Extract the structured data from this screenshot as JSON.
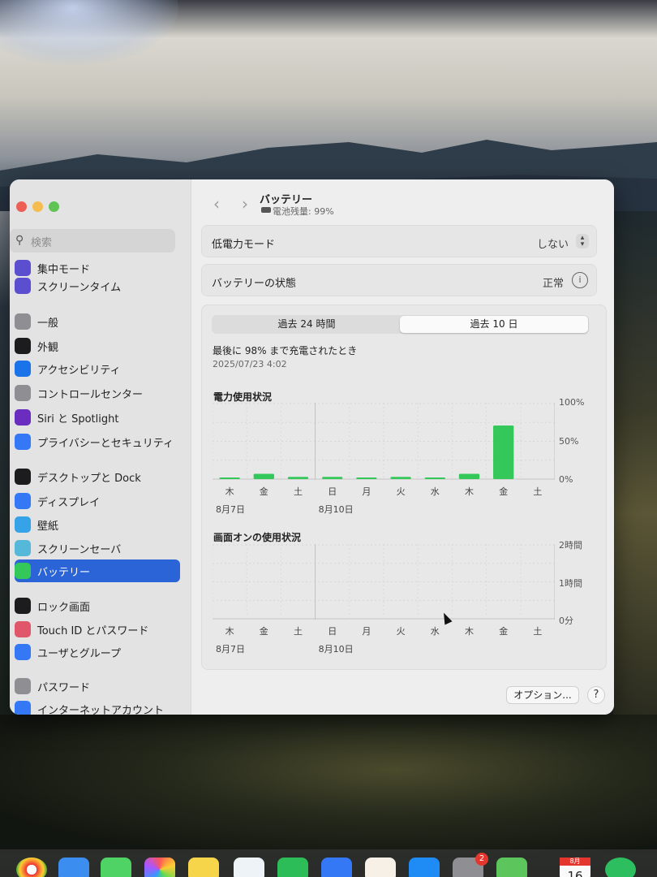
{
  "sidebar": {
    "search_placeholder": "検索",
    "items": [
      {
        "label": "集中モード",
        "icon": "moon-icon",
        "color": "#5b4fd0"
      },
      {
        "label": "スクリーンタイム",
        "icon": "hourglass-icon",
        "color": "#5b4fd0"
      },
      {
        "label": "一般",
        "icon": "gear-icon",
        "color": "#8e8e93"
      },
      {
        "label": "外観",
        "icon": "appearance-icon",
        "color": "#1c1c1e"
      },
      {
        "label": "アクセシビリティ",
        "icon": "accessibility-icon",
        "color": "#1a73e8"
      },
      {
        "label": "コントロールセンター",
        "icon": "control-center-icon",
        "color": "#8e8e93"
      },
      {
        "label": "Siri と Spotlight",
        "icon": "siri-icon",
        "color": "#6b2dbf"
      },
      {
        "label": "プライバシーとセキュリティ",
        "icon": "hand-icon",
        "color": "#3478f6"
      },
      {
        "label": "デスクトップと Dock",
        "icon": "desktop-icon",
        "color": "#1c1c1e"
      },
      {
        "label": "ディスプレイ",
        "icon": "sun-icon",
        "color": "#3478f6"
      },
      {
        "label": "壁紙",
        "icon": "flower-icon",
        "color": "#36a3e8"
      },
      {
        "label": "スクリーンセーバ",
        "icon": "screensaver-icon",
        "color": "#56b8d8"
      },
      {
        "label": "バッテリー",
        "icon": "battery-icon",
        "color": "#34c759"
      },
      {
        "label": "ロック画面",
        "icon": "lock-icon",
        "color": "#1c1c1e"
      },
      {
        "label": "Touch ID とパスワード",
        "icon": "fingerprint-icon",
        "color": "#e0566a"
      },
      {
        "label": "ユーザとグループ",
        "icon": "users-icon",
        "color": "#3478f6"
      },
      {
        "label": "パスワード",
        "icon": "key-icon",
        "color": "#8e8e93"
      },
      {
        "label": "インターネットアカウント",
        "icon": "at-icon",
        "color": "#3478f6"
      }
    ]
  },
  "header": {
    "title": "バッテリー",
    "battery_level": "電池残量: 99%"
  },
  "low_power": {
    "label": "低電力モード",
    "value": "しない"
  },
  "battery_health": {
    "label": "バッテリーの状態",
    "value": "正常"
  },
  "tabs": [
    {
      "label": "過去 24 時間",
      "active": false
    },
    {
      "label": "過去 10 日",
      "active": true
    }
  ],
  "last_charged": {
    "text": "最後に 98% まで充電されたとき",
    "date": "2025/07/23 4:02"
  },
  "buttons": {
    "options": "オプション...",
    "help": "?"
  },
  "dock": {
    "calendar_month": "8月",
    "calendar_day": "16",
    "badge": "2"
  },
  "chart_data": [
    {
      "type": "bar",
      "title": "電力使用状況",
      "categories": [
        "木",
        "金",
        "土",
        "日",
        "月",
        "火",
        "水",
        "木",
        "金",
        "土"
      ],
      "values": [
        1,
        7,
        3,
        3,
        1,
        3,
        2,
        7,
        71,
        0
      ],
      "ylim": [
        0,
        100
      ],
      "yticks": [
        "100%",
        "50%",
        "0%"
      ],
      "date_labels": [
        "8月7日",
        "8月10日"
      ],
      "color": "#34c759"
    },
    {
      "type": "bar",
      "title": "画面オンの使用状況",
      "categories": [
        "木",
        "金",
        "土",
        "日",
        "月",
        "火",
        "水",
        "木",
        "金",
        "土"
      ],
      "values": [
        0,
        0,
        0,
        0,
        0,
        0,
        0,
        0,
        0,
        0
      ],
      "yticks": [
        "2時間",
        "1時間",
        "0分"
      ],
      "date_labels": [
        "8月7日",
        "8月10日"
      ],
      "color": "#3478f6"
    }
  ]
}
